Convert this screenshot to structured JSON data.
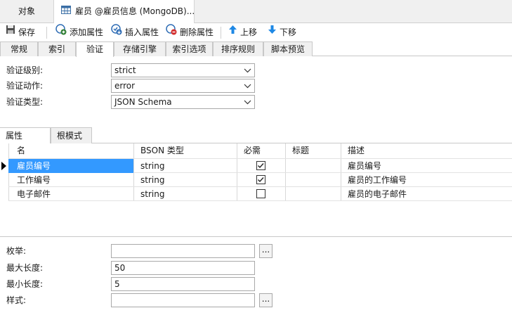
{
  "doc_tabs": [
    {
      "label": "对象"
    },
    {
      "label": "雇员 @雇员信息 (MongoDB)..."
    }
  ],
  "toolbar": {
    "save": "保存",
    "add_property": "添加属性",
    "insert_property": "插入属性",
    "delete_property": "删除属性",
    "move_up": "上移",
    "move_down": "下移"
  },
  "subtabs": [
    "常规",
    "索引",
    "验证",
    "存储引擎",
    "索引选项",
    "排序规则",
    "脚本预览"
  ],
  "active_subtab": "验证",
  "validation": {
    "level_label": "验证级别:",
    "level_value": "strict",
    "action_label": "验证动作:",
    "action_value": "error",
    "type_label": "验证类型:",
    "type_value": "JSON Schema"
  },
  "prop_tabs": [
    "属性",
    "根模式"
  ],
  "grid": {
    "columns": [
      "名",
      "BSON 类型",
      "必需",
      "标题",
      "描述"
    ],
    "rows": [
      {
        "name": "雇员编号",
        "type": "string",
        "required": true,
        "title": "",
        "desc": "雇员编号"
      },
      {
        "name": "工作编号",
        "type": "string",
        "required": true,
        "title": "",
        "desc": "雇员的工作编号"
      },
      {
        "name": "电子邮件",
        "type": "string",
        "required": false,
        "title": "",
        "desc": "雇员的电子邮件"
      }
    ]
  },
  "fields": {
    "enum_label": "枚举:",
    "enum_value": "",
    "max_len_label": "最大长度:",
    "max_len_value": "50",
    "min_len_label": "最小长度:",
    "min_len_value": "5",
    "pattern_label": "样式:",
    "pattern_value": "",
    "ellipsis": "..."
  },
  "colors": {
    "selection": "#3399ff",
    "add_icon": "#2e7d32",
    "delete_icon": "#d32f2f",
    "arrow_icon": "#1e88e5"
  }
}
